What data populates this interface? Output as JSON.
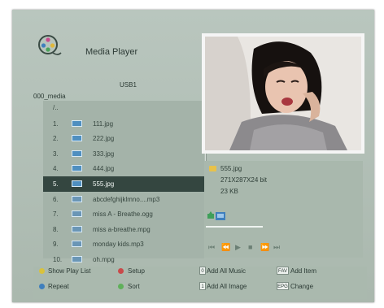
{
  "header": {
    "title": "Media Player",
    "logo_icon": "film-reel-icon"
  },
  "browser": {
    "device": "USB1",
    "path": "000_media",
    "up_dir": "/..",
    "files": [
      {
        "num": "1.",
        "type": "image",
        "name": "111.jpg"
      },
      {
        "num": "2.",
        "type": "image",
        "name": "222.jpg"
      },
      {
        "num": "3.",
        "type": "image",
        "name": "333.jpg"
      },
      {
        "num": "4.",
        "type": "image",
        "name": "444.jpg"
      },
      {
        "num": "5.",
        "type": "image",
        "name": "555.jpg"
      },
      {
        "num": "6.",
        "type": "music",
        "name": "abcdefghijklmno....mp3"
      },
      {
        "num": "7.",
        "type": "music",
        "name": "miss A - Breathe.ogg"
      },
      {
        "num": "8.",
        "type": "music",
        "name": "miss a-breathe.mpg"
      },
      {
        "num": "9.",
        "type": "music",
        "name": "monday kids.mp3"
      },
      {
        "num": "10.",
        "type": "music",
        "name": "oh.mpg"
      }
    ],
    "selected_index": 5
  },
  "info": {
    "filename": "555.jpg",
    "resolution": "271X287X24 bit",
    "size": "23 KB"
  },
  "controls": [
    "⏮",
    "⏪",
    "▶",
    "■",
    "⏩",
    "⏭"
  ],
  "footer": {
    "show_play_list": "Show Play List",
    "setup": "Setup",
    "repeat": "Repeat",
    "sort": "Sort",
    "key_0": "0",
    "add_all_music": "Add All  Music",
    "key_1": "1",
    "add_all_image": "Add All Image",
    "key_fav": "FAV",
    "add_item": "Add Item",
    "key_epg": "EPG",
    "change": "Change"
  },
  "colors": {
    "selected_row": "#344640",
    "yellow_button": "#d9c23c",
    "red_button": "#c94a4a",
    "blue_button": "#3f7fbd",
    "green_button": "#5fb05a"
  }
}
